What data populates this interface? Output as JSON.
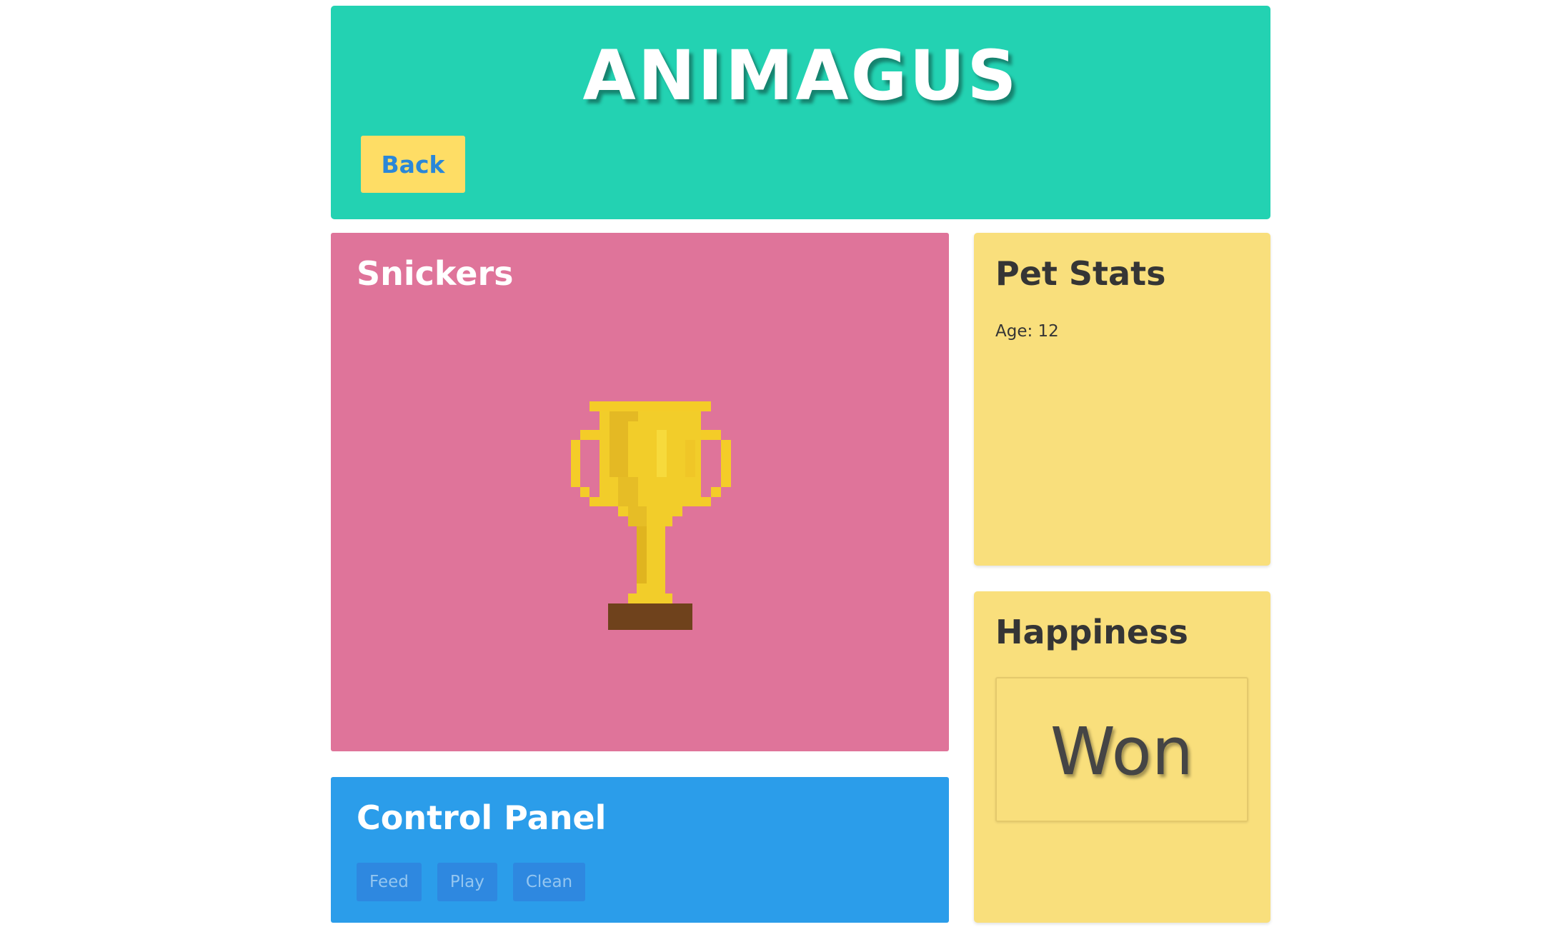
{
  "header": {
    "brand": "ANIMAGUS",
    "back_label": "Back"
  },
  "pet": {
    "name": "Snickers",
    "image_icon": "trophy-icon"
  },
  "stats": {
    "title": "Pet Stats",
    "age_line": "Age: 12"
  },
  "happiness": {
    "title": "Happiness",
    "value": "Won"
  },
  "control_panel": {
    "title": "Control Panel",
    "buttons": {
      "feed": "Feed",
      "play": "Play",
      "clean": "Clean"
    }
  },
  "colors": {
    "header_bg": "#23d2b2",
    "back_button_bg": "#fedd65",
    "back_button_text": "#2a87d8",
    "pet_card_bg": "#df749a",
    "stats_card_bg": "#f9df7c",
    "control_panel_bg": "#2b9dea",
    "control_button_bg": "#2e88e0",
    "trophy_gold": "#f2cd2a",
    "trophy_base": "#6f421c"
  }
}
